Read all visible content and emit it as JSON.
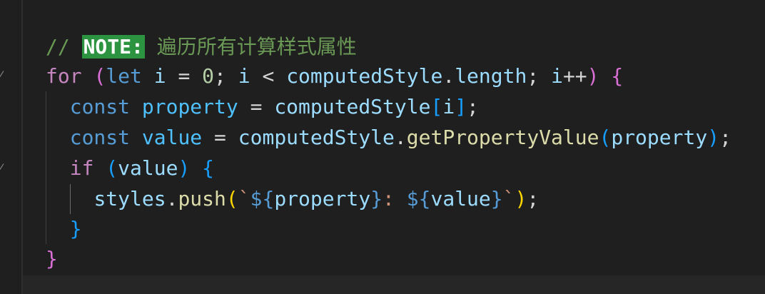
{
  "editor": {
    "language": "javascript",
    "lines": [
      {
        "tokens": [
          {
            "text": "// ",
            "cls": "comment"
          },
          {
            "text": "NOTE:",
            "cls": "note-tag"
          },
          {
            "text": " ",
            "cls": "comment"
          },
          {
            "text": "遍历所有计算样式属性",
            "cls": "cjk"
          }
        ]
      },
      {
        "tokens": [
          {
            "text": "for",
            "cls": "kw-ctrl"
          },
          {
            "text": " ",
            "cls": "op"
          },
          {
            "text": "(",
            "cls": "brace-2"
          },
          {
            "text": "let",
            "cls": "kw"
          },
          {
            "text": " ",
            "cls": "op"
          },
          {
            "text": "i",
            "cls": "var"
          },
          {
            "text": " = ",
            "cls": "op"
          },
          {
            "text": "0",
            "cls": "num"
          },
          {
            "text": "; ",
            "cls": "punc"
          },
          {
            "text": "i",
            "cls": "var"
          },
          {
            "text": " < ",
            "cls": "op"
          },
          {
            "text": "computedStyle",
            "cls": "var"
          },
          {
            "text": ".",
            "cls": "punc"
          },
          {
            "text": "length",
            "cls": "var"
          },
          {
            "text": "; ",
            "cls": "punc"
          },
          {
            "text": "i",
            "cls": "var"
          },
          {
            "text": "++",
            "cls": "op"
          },
          {
            "text": ")",
            "cls": "brace-2"
          },
          {
            "text": " ",
            "cls": "op"
          },
          {
            "text": "{",
            "cls": "brace-2"
          }
        ]
      },
      {
        "tokens": [
          {
            "text": "  ",
            "cls": "op"
          },
          {
            "text": "const",
            "cls": "kw"
          },
          {
            "text": " ",
            "cls": "op"
          },
          {
            "text": "property",
            "cls": "const-var"
          },
          {
            "text": " = ",
            "cls": "op"
          },
          {
            "text": "computedStyle",
            "cls": "var"
          },
          {
            "text": "[",
            "cls": "brace-3"
          },
          {
            "text": "i",
            "cls": "var"
          },
          {
            "text": "]",
            "cls": "brace-3"
          },
          {
            "text": ";",
            "cls": "punc"
          }
        ]
      },
      {
        "tokens": [
          {
            "text": "  ",
            "cls": "op"
          },
          {
            "text": "const",
            "cls": "kw"
          },
          {
            "text": " ",
            "cls": "op"
          },
          {
            "text": "value",
            "cls": "const-var"
          },
          {
            "text": " = ",
            "cls": "op"
          },
          {
            "text": "computedStyle",
            "cls": "var"
          },
          {
            "text": ".",
            "cls": "punc"
          },
          {
            "text": "getPropertyValue",
            "cls": "fn"
          },
          {
            "text": "(",
            "cls": "brace-3"
          },
          {
            "text": "property",
            "cls": "var"
          },
          {
            "text": ")",
            "cls": "brace-3"
          },
          {
            "text": ";",
            "cls": "punc"
          }
        ]
      },
      {
        "tokens": [
          {
            "text": "  ",
            "cls": "op"
          },
          {
            "text": "if",
            "cls": "kw-ctrl"
          },
          {
            "text": " ",
            "cls": "op"
          },
          {
            "text": "(",
            "cls": "brace-3"
          },
          {
            "text": "value",
            "cls": "var"
          },
          {
            "text": ")",
            "cls": "brace-3"
          },
          {
            "text": " ",
            "cls": "op"
          },
          {
            "text": "{",
            "cls": "brace-3"
          }
        ]
      },
      {
        "tokens": [
          {
            "text": "    ",
            "cls": "op"
          },
          {
            "text": "styles",
            "cls": "var"
          },
          {
            "text": ".",
            "cls": "punc"
          },
          {
            "text": "push",
            "cls": "fn"
          },
          {
            "text": "(",
            "cls": "brace-1"
          },
          {
            "text": "`",
            "cls": "str"
          },
          {
            "text": "${",
            "cls": "kw"
          },
          {
            "text": "property",
            "cls": "var"
          },
          {
            "text": "}",
            "cls": "kw"
          },
          {
            "text": ": ",
            "cls": "str"
          },
          {
            "text": "${",
            "cls": "kw"
          },
          {
            "text": "value",
            "cls": "var"
          },
          {
            "text": "}",
            "cls": "kw"
          },
          {
            "text": "`",
            "cls": "str"
          },
          {
            "text": ")",
            "cls": "brace-1"
          },
          {
            "text": ";",
            "cls": "punc"
          }
        ]
      },
      {
        "tokens": [
          {
            "text": "  ",
            "cls": "op"
          },
          {
            "text": "}",
            "cls": "brace-3"
          }
        ]
      },
      {
        "tokens": [
          {
            "text": "}",
            "cls": "brace-2"
          }
        ]
      }
    ]
  },
  "colors": {
    "background": "#1f1f1f",
    "comment": "#6a9955",
    "note_highlight": "#2c9440",
    "keyword": "#569cd6",
    "control_keyword": "#c586c0",
    "variable": "#9cdcfe",
    "constant": "#4fc1ff",
    "function": "#dcdcaa",
    "number": "#b5cea8",
    "string": "#ce9178"
  },
  "gutter": {
    "fold_icon": "fold-chevron-icon"
  }
}
